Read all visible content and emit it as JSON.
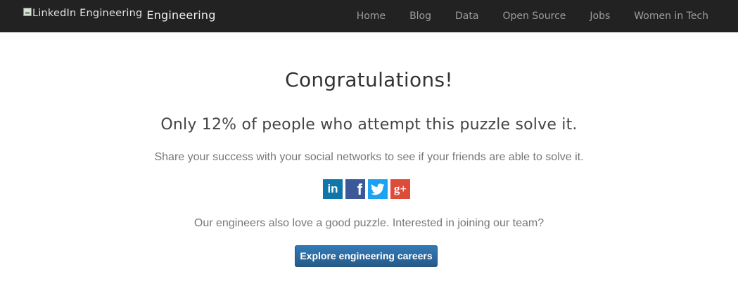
{
  "header": {
    "logo_alt": "LinkedIn Engineering",
    "brand_text": "Engineering",
    "nav": [
      {
        "label": "Home"
      },
      {
        "label": "Blog"
      },
      {
        "label": "Data"
      },
      {
        "label": "Open Source"
      },
      {
        "label": "Jobs"
      },
      {
        "label": "Women in Tech"
      }
    ],
    "background_color": "#222222"
  },
  "main": {
    "headline": "Congratulations!",
    "subhead": "Only 12% of people who attempt this puzzle solve it.",
    "share_text": "Share your success with your social networks to see if your friends are able to solve it.",
    "social": [
      {
        "name": "linkedin",
        "icon": "linkedin-icon",
        "glyph": "in",
        "color": "#0e76a8"
      },
      {
        "name": "facebook",
        "icon": "facebook-icon",
        "glyph": "f",
        "color": "#3b5998"
      },
      {
        "name": "twitter",
        "icon": "twitter-icon",
        "glyph": "",
        "color": "#1da1f2"
      },
      {
        "name": "googleplus",
        "icon": "google-plus-icon",
        "glyph": "g+",
        "color": "#dd4b39"
      }
    ],
    "engineers_text": "Our engineers also love a good puzzle. Interested in joining our team?",
    "cta_label": "Explore engineering careers",
    "cta_color": "#2b6db0"
  }
}
